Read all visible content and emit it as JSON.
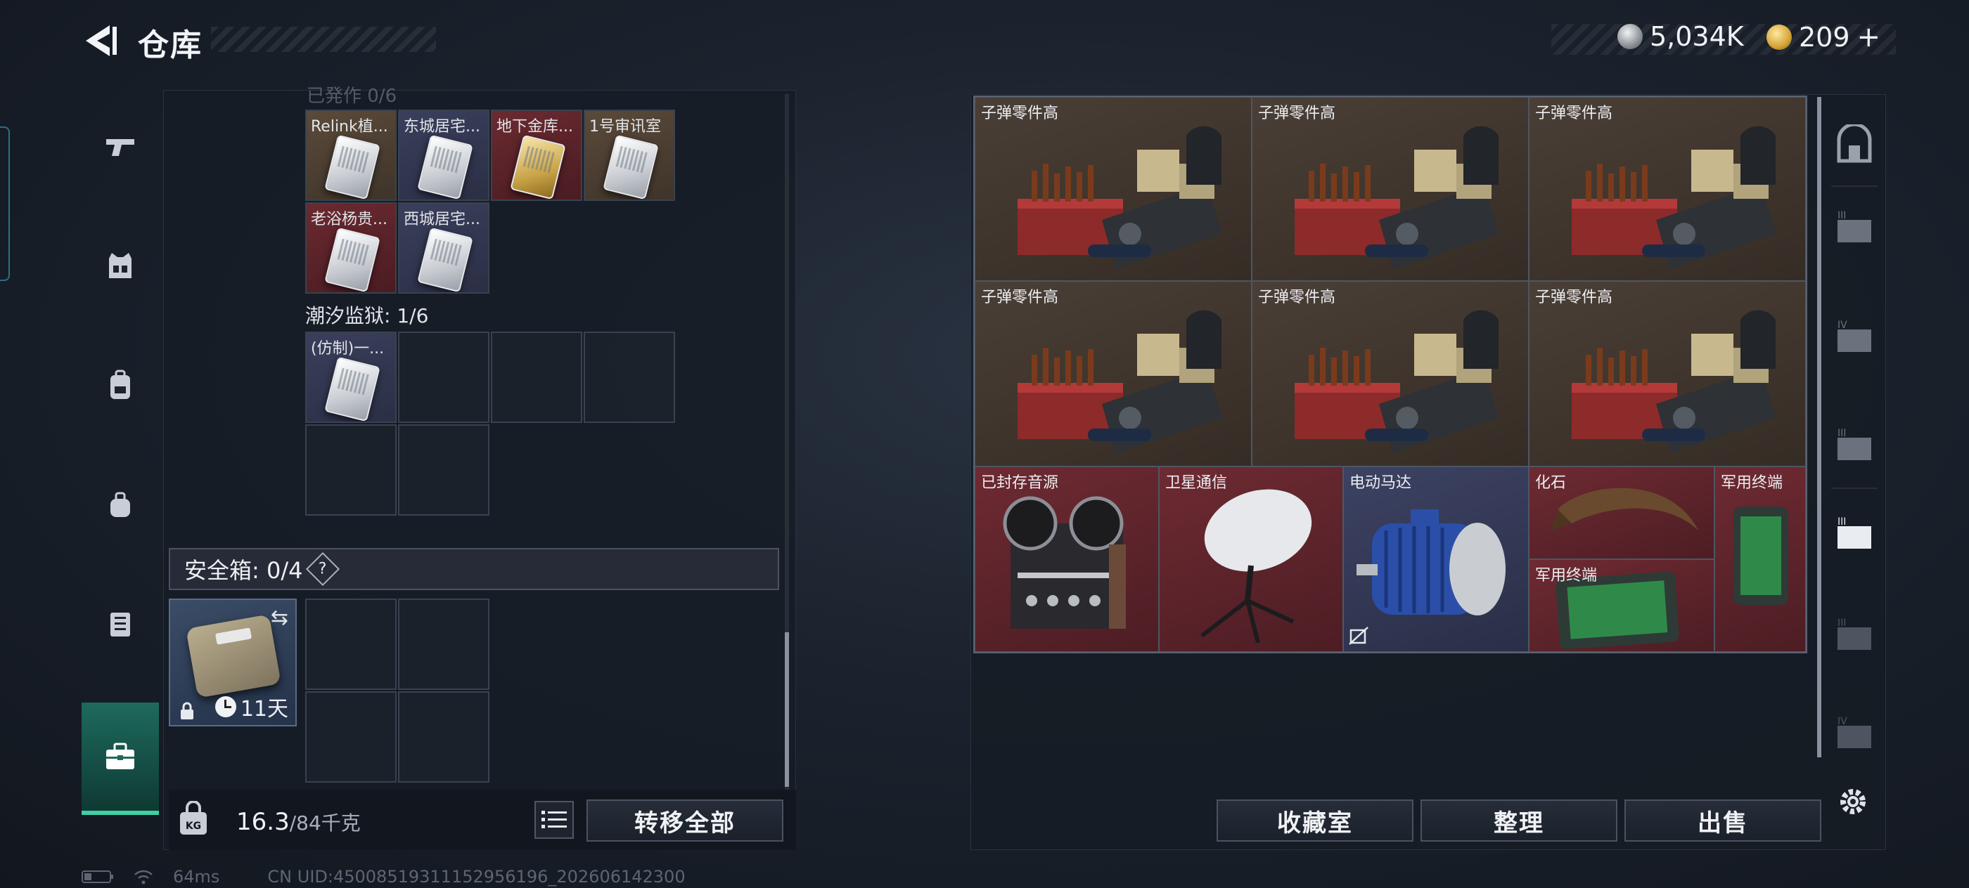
{
  "header": {
    "title": "仓库",
    "currencies": [
      {
        "name": "silver",
        "value": "5,034K"
      },
      {
        "name": "gold",
        "value": "209"
      }
    ],
    "add_symbol": "+"
  },
  "left_panel": {
    "cut_header": "已発作 0/6",
    "cards_top": [
      {
        "label": "Relink植...",
        "tone": "gold"
      },
      {
        "label": "东城居宅...",
        "tone": "blue"
      },
      {
        "label": "地下金库...",
        "tone": "red"
      },
      {
        "label": "1号审讯室",
        "tone": "gold"
      },
      {
        "label": "老浴杨贵...",
        "tone": "red"
      },
      {
        "label": "西城居宅...",
        "tone": "blue"
      }
    ],
    "prison_title": "潮汐监狱: 1/6",
    "prison_cards": [
      {
        "label": "(仿制)一...",
        "tone": "blue"
      }
    ],
    "safe_box": {
      "title": "安全箱: 0/4",
      "help": "?",
      "days": "11天",
      "swap_symbol": "⇆"
    },
    "weight": {
      "current": "16.3",
      "max": "/84千克"
    },
    "transfer_all": "转移全部"
  },
  "right_panel": {
    "items": [
      {
        "label": "子弹零件高"
      },
      {
        "label": "子弹零件高"
      },
      {
        "label": "子弹零件高"
      },
      {
        "label": "子弹零件高"
      },
      {
        "label": "子弹零件高"
      },
      {
        "label": "子弹零件高"
      }
    ],
    "small_items": [
      {
        "label": "已封存音源"
      },
      {
        "label": "卫星通信"
      },
      {
        "label": "电动马达"
      },
      {
        "label": "化石"
      },
      {
        "label": "军用终端"
      },
      {
        "label": "军用终端"
      }
    ],
    "buttons": {
      "collection": "收藏室",
      "organize": "整理",
      "sell": "出售"
    },
    "right_nav": [
      {
        "roman": ""
      },
      {
        "roman": "III"
      },
      {
        "roman": "IV"
      },
      {
        "roman": "III"
      },
      {
        "roman": "III"
      },
      {
        "roman": "III"
      },
      {
        "roman": "IV"
      }
    ]
  },
  "status_bar": {
    "ping": "64ms",
    "uid": "CN UID:45008519311152956196_202606142300"
  },
  "colors": {
    "accent": "#3fd0a6",
    "red_item": "#6e2a32",
    "brown_item": "#4a3f36",
    "blue_item": "#3c4262"
  }
}
